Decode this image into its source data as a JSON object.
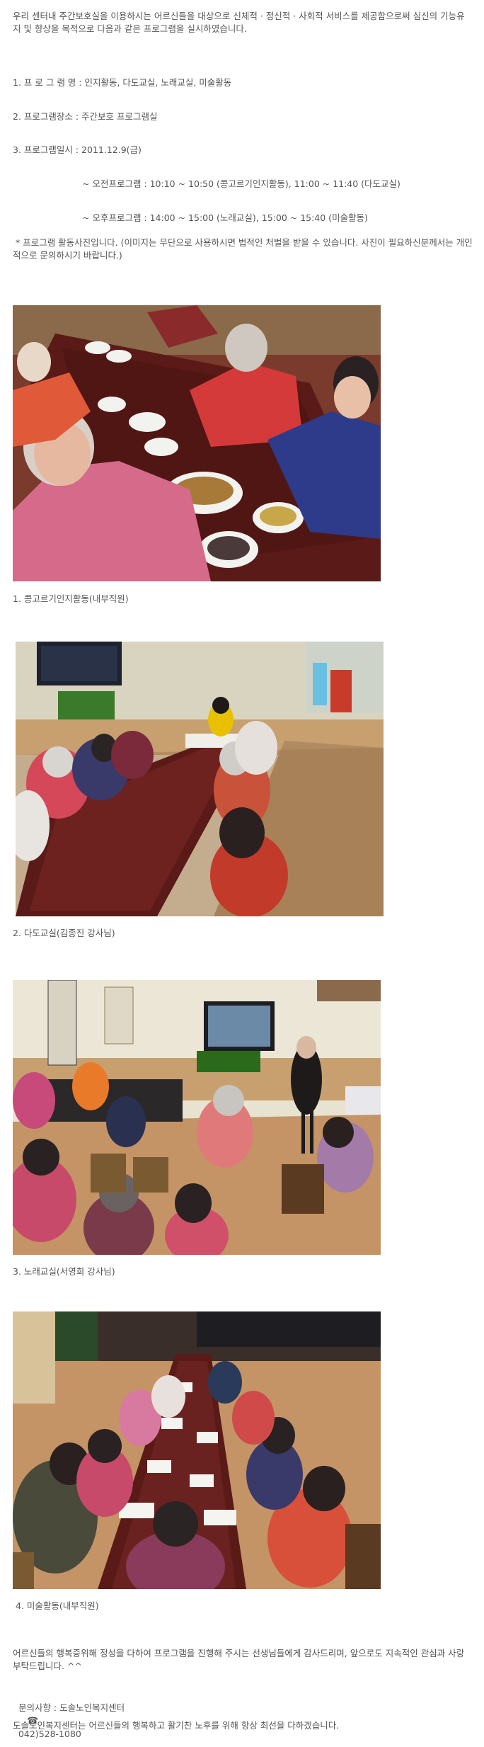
{
  "intro": "우리 센터내 주간보호실을 이용하시는 어르신들을 대상으로 신체적 · 정신적 · 사회적 서비스를 제공함으로써 심신의 기능유지 및 향상을 목적으로 다음과 같은 프로그램을 실시하였습니다.",
  "items": {
    "name": "1. 프 로 그 램 명 : 인지활동, 다도교실, 노래교실, 미술활동",
    "place": "2. 프로그램장소 : 주간보호 프로그램실",
    "date": "3. 프로그램일시 : 2011.12.9(금)",
    "morning": "~ 오전프로그램 : 10:10 ~ 10:50 (콩고르기인지활동), 11:00 ~ 11:40 (다도교실)",
    "afternoon": "~ 오후프로그램 : 14:00 ~ 15:00 (노래교실), 15:00 ~ 15:40 (미술활동)"
  },
  "notice": " * 프로그램 활동사진입니다. (이미지는 무단으로 사용하시면 법적인 처벌을 받을 수 있습니다. 사진이 필요하신분께서는 개인적으로 문의하시기 바랍니다.)",
  "photos": [
    {
      "caption": "1. 콩고르기인지활동(내부직원)",
      "icon": "photo-bean-sorting"
    },
    {
      "caption": "2. 다도교실(김종진 강사님)",
      "icon": "photo-tea-class"
    },
    {
      "caption": "3. 노래교실(서영희 강사님)",
      "icon": "photo-singing-class"
    },
    {
      "caption": "4. 미술활동(내부직원)",
      "icon": "photo-art-activity"
    }
  ],
  "closing": "어르신들의 행복증위해 정성을 다하여 프로그램을 진행해 주시는 선생님들에게 감사드리며, 앞으로도 지속적인 관심과 사랑 부탁드립니다. ^^",
  "contact": {
    "label": "문의사항 : 도솔노인복지센터",
    "phone_icon": "phone-icon",
    "phone": "042)528-1080"
  },
  "footer": "도솔노인복지센터는 어르신들의 행복하고 활기찬 노후를 위해 항상 최선을 다하겠습니다."
}
